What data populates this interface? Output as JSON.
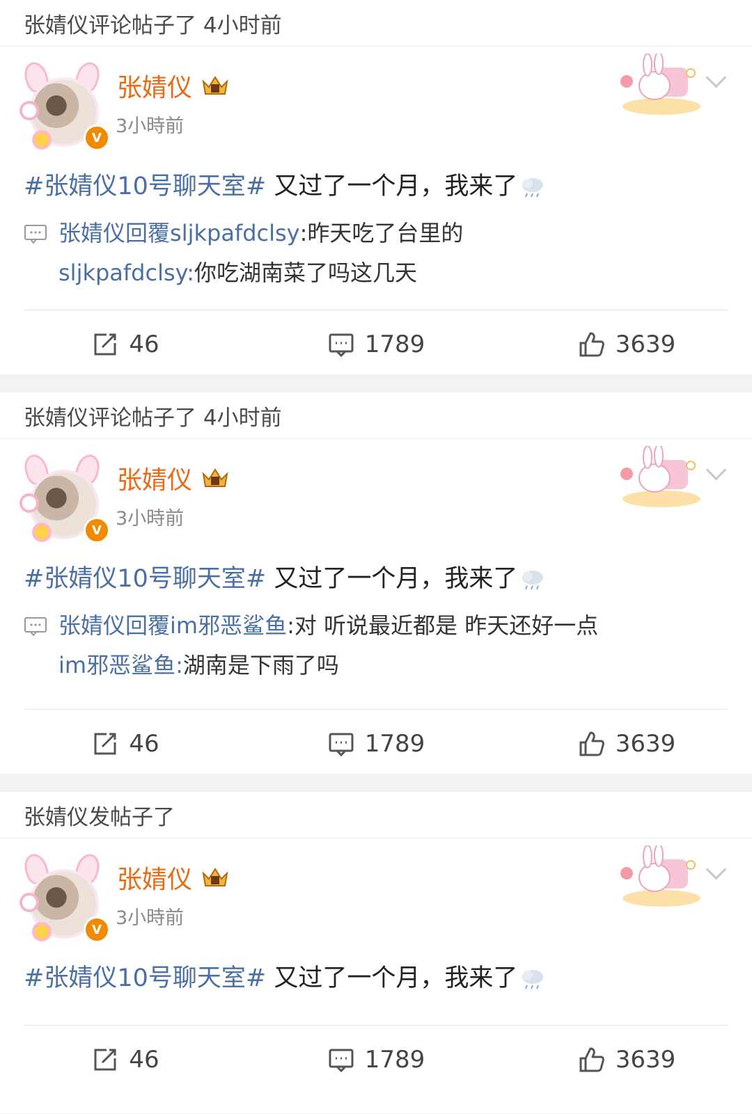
{
  "colors": {
    "accent": "#e86b16",
    "link": "#4a6fa5",
    "verify": "#f08a00",
    "page_bg": "#f2f2f2"
  },
  "posts": [
    {
      "activity": "张婧仪评论帖子了 4小时前",
      "author": "张婧仪",
      "time": "3小時前",
      "topic": "#张婧仪10号聊天室#",
      "text": " 又过了一个月，我来了",
      "reply": {
        "prefix": "张婧仪回覆",
        "target": "sljkpafdclsy",
        "reply_text": " :昨天吃了台里的",
        "quote_user": "sljkpafdclsy:",
        "quote_text": " 你吃湖南菜了吗这几天"
      },
      "reposts": "46",
      "comments": "1789",
      "likes": "3639"
    },
    {
      "activity": "张婧仪评论帖子了 4小时前",
      "author": "张婧仪",
      "time": "3小時前",
      "topic": "#张婧仪10号聊天室#",
      "text": " 又过了一个月，我来了",
      "reply": {
        "prefix": "张婧仪回覆",
        "target": "im邪恶鲨鱼",
        "reply_text": " :对 听说最近都是 昨天还好一点",
        "quote_user": "im邪恶鲨鱼:",
        "quote_text": " 湖南是下雨了吗"
      },
      "reposts": "46",
      "comments": "1789",
      "likes": "3639"
    },
    {
      "activity": "张婧仪发帖子了",
      "author": "张婧仪",
      "time": "3小時前",
      "topic": "#张婧仪10号聊天室#",
      "text": " 又过了一个月，我来了",
      "reposts": "46",
      "comments": "1789",
      "likes": "3639"
    }
  ]
}
